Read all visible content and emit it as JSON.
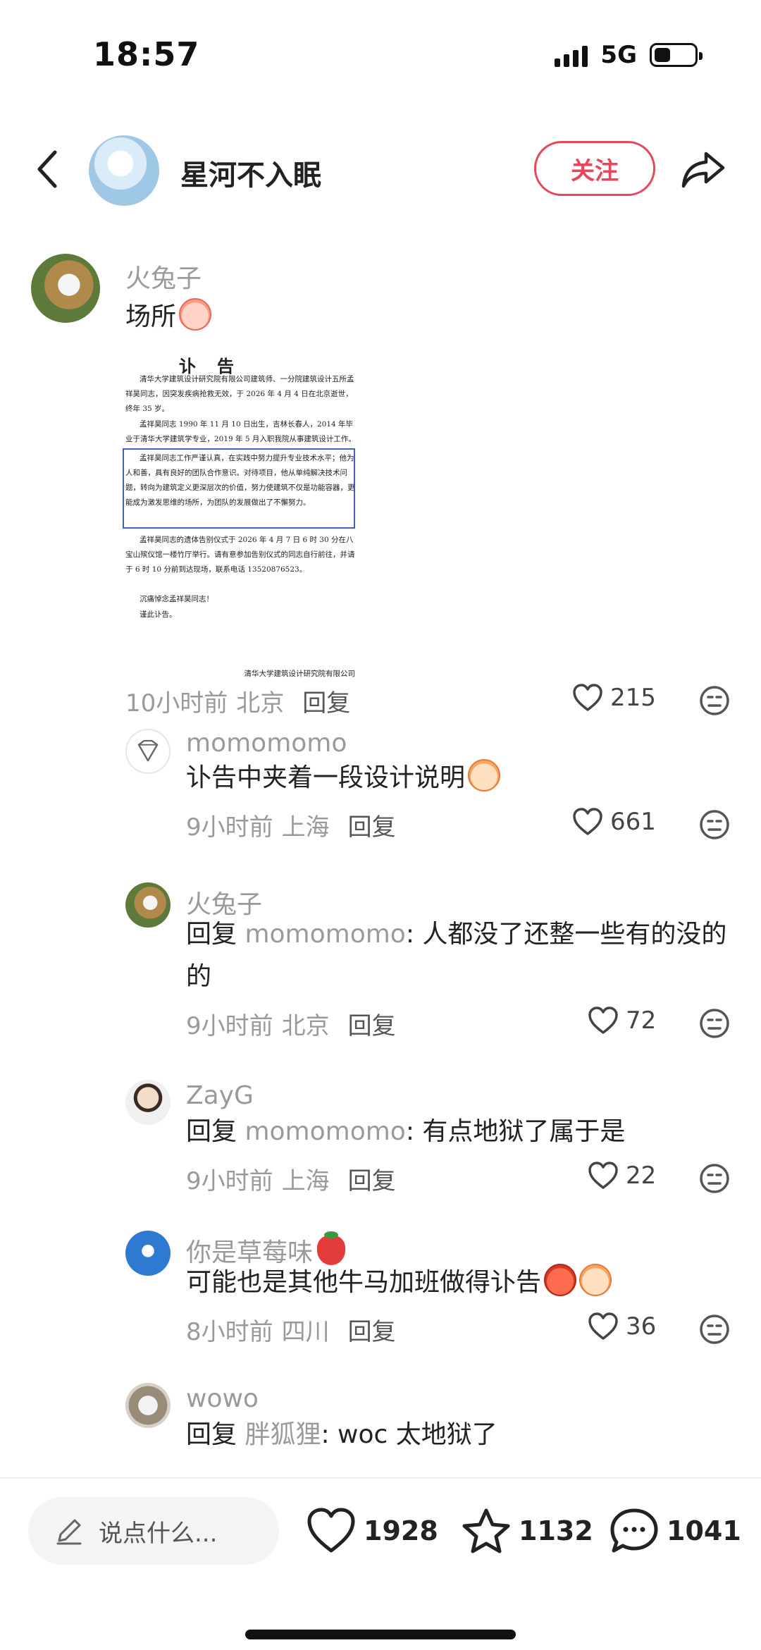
{
  "status_bar": {
    "time": "18:57",
    "network": "5G"
  },
  "header": {
    "username": "星河不入眠",
    "follow_label": "关注"
  },
  "comments": [
    {
      "username": "火兔子",
      "text": "场所",
      "notice": {
        "title": "讣告",
        "paragraphs": [
          "清华大学建筑设计研究院有限公司建筑师、一分院建筑设计五所孟祥昊同志，因突发疾病抢救无效，于 2026 年 4 月 4 日在北京逝世，终年 35 岁。",
          "孟祥昊同志 1990 年 11 月 10 日出生，吉林长春人，2014 年毕业于清华大学建筑学专业，2019 年 5 月入职我院从事建筑设计工作。",
          "孟祥昊同志工作严谨认真，在实践中努力提升专业技术水平；他为人和善，具有良好的团队合作意识。对待项目，他从单纯解决技术问题，转向为建筑定义更深层次的价值，努力使建筑不仅是功能容器，更能成为激发思维的场所，为团队的发展做出了不懈努力。",
          "孟祥昊同志的遗体告别仪式于 2026 年 4 月 7 日 6 时 30 分在八宝山殡仪馆一楼竹厅举行。请有意参加告别仪式的同志自行前往，并请于 6 时 10 分前到达现场，联系电话 13520876523。"
        ],
        "closing_1": "沉痛悼念孟祥昊同志！",
        "closing_2": "谨此讣告。",
        "signature": "清华大学建筑设计研究院有限公司"
      },
      "time": "10小时前",
      "location": "北京",
      "reply_label": "回复",
      "likes": "215"
    },
    {
      "username": "momomomo",
      "text": "讣告中夹着一段设计说明",
      "time": "9小时前",
      "location": "上海",
      "reply_label": "回复",
      "likes": "661"
    },
    {
      "username": "火兔子",
      "reply_prefix": "回复 ",
      "mention": "momomomo",
      "text": ": 人都没了还整一些有的没的的",
      "time": "9小时前",
      "location": "北京",
      "reply_label": "回复",
      "likes": "72"
    },
    {
      "username": "ZayG",
      "reply_prefix": "回复 ",
      "mention": "momomomo",
      "text": ": 有点地狱了属于是",
      "time": "9小时前",
      "location": "上海",
      "reply_label": "回复",
      "likes": "22"
    },
    {
      "username": "你是草莓味",
      "text": "可能也是其他牛马加班做得讣告",
      "time": "8小时前",
      "location": "四川",
      "reply_label": "回复",
      "likes": "36"
    },
    {
      "username": "wowo",
      "reply_prefix": "回复 ",
      "mention": "胖狐狸",
      "text": ": woc 太地狱了"
    }
  ],
  "bottom_bar": {
    "placeholder": "说点什么...",
    "likes": "1928",
    "favorites": "1132",
    "comments": "1041"
  },
  "colors": {
    "accent": "#e8465a",
    "muted": "#9a9a9a"
  },
  "icons": [
    "back-icon",
    "share-icon",
    "heart-icon",
    "dislike-icon",
    "pencil-icon",
    "star-icon",
    "comment-bubble-icon"
  ]
}
